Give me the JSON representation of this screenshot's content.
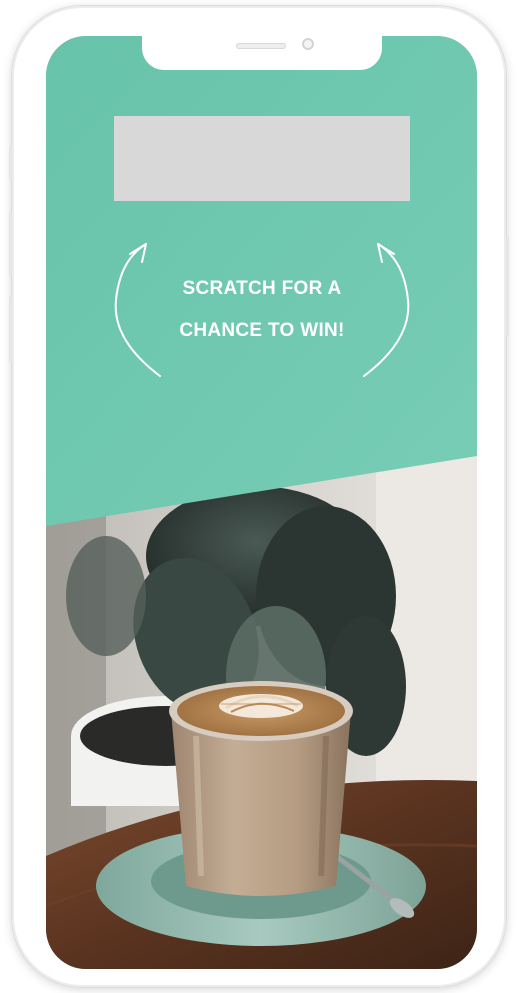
{
  "promo": {
    "cta_line1": "SCRATCH FOR A",
    "cta_line2": "CHANCE TO WIN!"
  },
  "colors": {
    "panel": "#6dc8b0",
    "scratch_area": "#d8d8d8",
    "text": "#ffffff"
  },
  "icons": {
    "left": "curved-arrow-up-left-icon",
    "right": "curved-arrow-up-right-icon"
  }
}
